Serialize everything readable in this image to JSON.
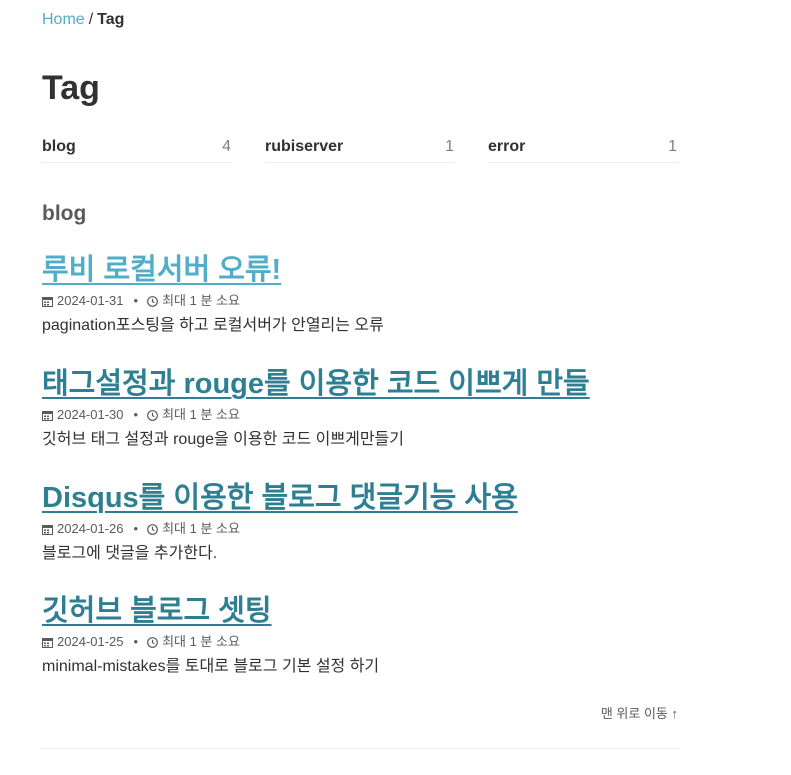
{
  "breadcrumb": {
    "home": "Home",
    "separator": "/",
    "current": "Tag"
  },
  "page_title": "Tag",
  "taxonomy": [
    {
      "name": "blog",
      "count": "4"
    },
    {
      "name": "rubiserver",
      "count": "1"
    },
    {
      "name": "error",
      "count": "1"
    }
  ],
  "section_title": "blog",
  "posts": [
    {
      "title": "루비 로컬서버 오류!",
      "date": "2024-01-31",
      "read_time": "최대 1 분 소요",
      "excerpt": "pagination포스팅을 하고 로컬서버가 안열리는 오류"
    },
    {
      "title": "태그설정과 rouge를 이용한 코드 이쁘게 만들",
      "date": "2024-01-30",
      "read_time": "최대 1 분 소요",
      "excerpt": "깃허브 태그 설정과 rouge을 이용한 코드 이쁘게만들기"
    },
    {
      "title": "Disqus를 이용한 블로그 댓글기능 사용",
      "date": "2024-01-26",
      "read_time": "최대 1 분 소요",
      "excerpt": "블로그에 댓글을 추가한다."
    },
    {
      "title": "깃허브 블로그 셋팅",
      "date": "2024-01-25",
      "read_time": "최대 1 분 소요",
      "excerpt": "minimal-mistakes를 토대로 블로그 기본 설정 하기"
    }
  ],
  "meta_separator": "•",
  "back_to_top": "맨 위로 이동 ↑",
  "icons": {
    "date": "calendar-icon",
    "read_time": "clock-icon"
  },
  "colors": {
    "link": "#52adc8",
    "link_visited": "#2f7f93",
    "text": "#313131",
    "muted": "#5a5a5a",
    "rule": "#eeeeee"
  }
}
